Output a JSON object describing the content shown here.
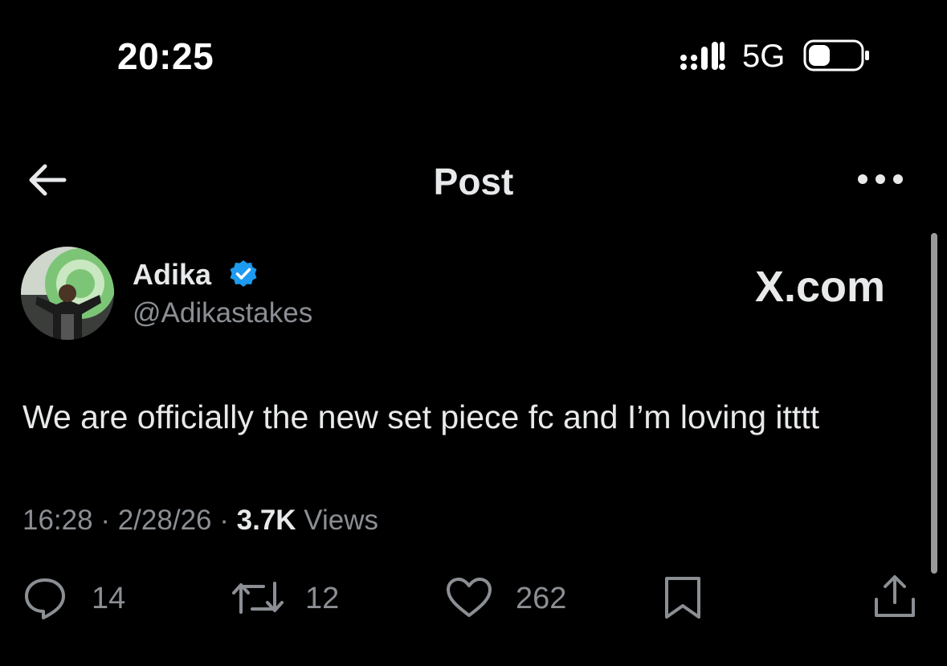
{
  "status_bar": {
    "time": "20:25",
    "network": "5G",
    "signal_icon": "cellular-signal-icon",
    "battery_icon": "battery-icon"
  },
  "nav": {
    "title": "Post",
    "back_icon": "back-arrow-icon",
    "more_icon": "more-options-icon"
  },
  "post": {
    "author_name": "Adika",
    "author_handle": "@Adikastakes",
    "verified_icon": "verified-badge-icon",
    "watermark": "X.com",
    "text": "We are officially the new set piece fc and I’m loving itttt",
    "time": "16:28",
    "date": "2/28/26",
    "separator": "·",
    "views_count": "3.7K",
    "views_label": "Views"
  },
  "actions": {
    "replies": "14",
    "reposts": "12",
    "likes": "262",
    "reply_icon": "reply-icon",
    "repost_icon": "repost-icon",
    "like_icon": "heart-icon",
    "bookmark_icon": "bookmark-icon",
    "share_icon": "share-icon"
  },
  "colors": {
    "background": "#000000",
    "text_primary": "#e7e9ea",
    "text_secondary": "#8b8f94",
    "verified_blue": "#1d9bf0",
    "avatar_green": "#7cc576"
  }
}
